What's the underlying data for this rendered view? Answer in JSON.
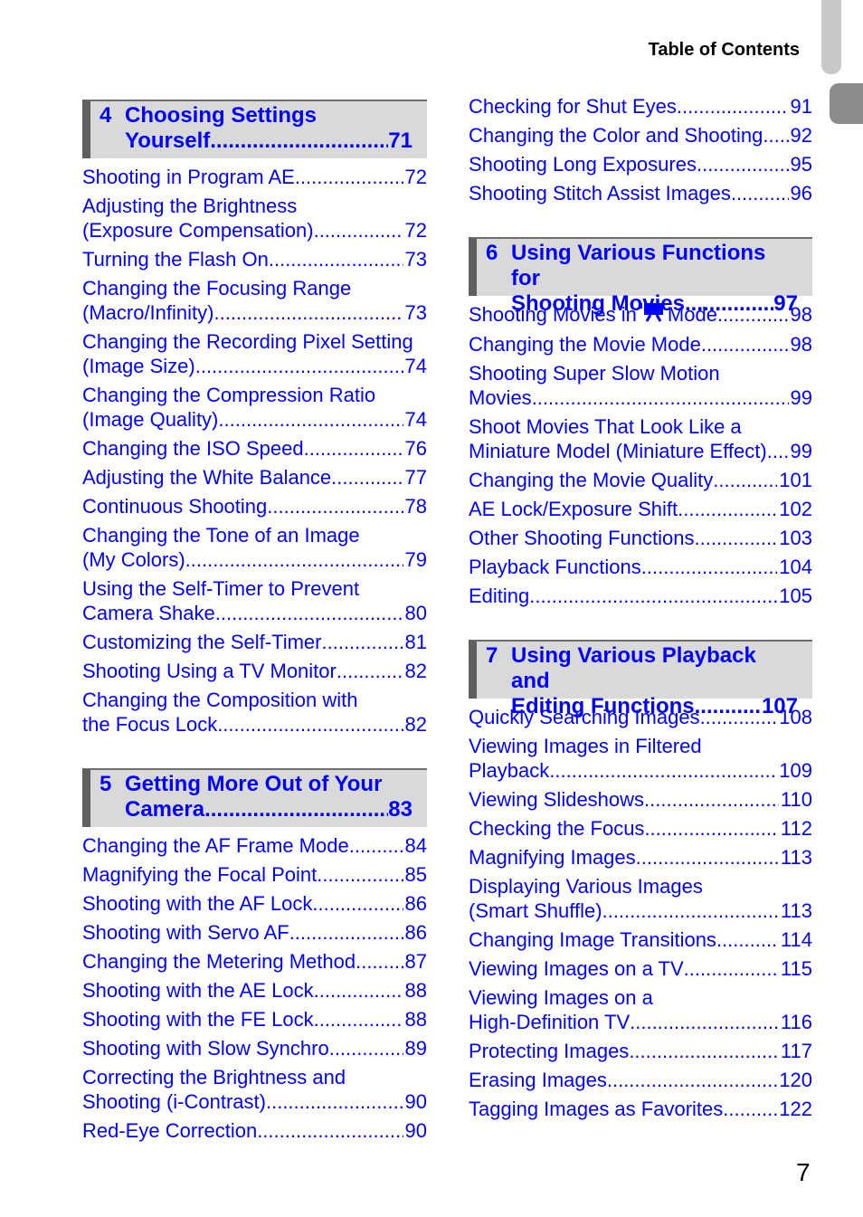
{
  "header": {
    "title": "Table of Contents"
  },
  "page_number": "7",
  "icons": {
    "movie_mode": "movie-camera-icon"
  },
  "left": [
    {
      "chapter": {
        "num": "4",
        "line1": "Choosing Settings",
        "line2": "Yourself",
        "page": "71"
      },
      "entries": [
        {
          "text": "Shooting in Program AE",
          "page": "72"
        },
        {
          "line1": "Adjusting the Brightness",
          "text": "(Exposure Compensation)",
          "page": "72"
        },
        {
          "text": "Turning the Flash On",
          "page": "73"
        },
        {
          "line1": "Changing the Focusing Range",
          "text": "(Macro/Infinity)",
          "page": "73"
        },
        {
          "line1": "Changing the Recording Pixel Setting",
          "text": "(Image Size)",
          "page": "74"
        },
        {
          "line1": "Changing the Compression Ratio",
          "text": "(Image Quality)",
          "page": "74"
        },
        {
          "text": "Changing the ISO Speed",
          "page": "76"
        },
        {
          "text": "Adjusting the White Balance",
          "page": "77"
        },
        {
          "text": "Continuous Shooting",
          "page": "78"
        },
        {
          "line1": "Changing the Tone of an Image",
          "text": "(My Colors)",
          "page": "79"
        },
        {
          "line1": "Using the Self-Timer to Prevent",
          "text": "Camera Shake",
          "page": "80"
        },
        {
          "text": "Customizing the Self-Timer",
          "page": "81"
        },
        {
          "text": "Shooting Using a TV Monitor",
          "page": "82"
        },
        {
          "line1": "Changing the Composition with",
          "text": "the Focus Lock",
          "page": "82"
        }
      ]
    },
    {
      "chapter": {
        "num": "5",
        "line1": "Getting More Out of Your",
        "line2": "Camera",
        "page": "83"
      },
      "entries": [
        {
          "text": "Changing the AF Frame Mode",
          "page": "84"
        },
        {
          "text": "Magnifying the Focal Point",
          "page": "85"
        },
        {
          "text": "Shooting with the AF Lock",
          "page": "86"
        },
        {
          "text": "Shooting with Servo AF",
          "page": "86"
        },
        {
          "text": "Changing the Metering Method",
          "page": "87"
        },
        {
          "text": "Shooting with the AE Lock",
          "page": "88"
        },
        {
          "text": "Shooting with the FE Lock",
          "page": "88"
        },
        {
          "text": "Shooting with Slow Synchro",
          "page": "89"
        },
        {
          "line1": "Correcting the Brightness and",
          "text": "Shooting (i-Contrast)",
          "page": "90"
        },
        {
          "text": "Red-Eye Correction",
          "page": "90"
        }
      ]
    }
  ],
  "right_top": [
    {
      "text": "Checking for Shut Eyes",
      "page": "91"
    },
    {
      "text": "Changing the Color and Shooting",
      "page": "92"
    },
    {
      "text": "Shooting Long Exposures",
      "page": "95"
    },
    {
      "text": "Shooting Stitch Assist Images",
      "page": "96"
    }
  ],
  "right": [
    {
      "chapter": {
        "num": "6",
        "line1": "Using Various Functions for",
        "line2": "Shooting Movies",
        "page": "97"
      },
      "movie_entry": {
        "before": "Shooting Movies in",
        "after": "Mode",
        "page": "98"
      },
      "entries": [
        {
          "text": "Changing the Movie Mode",
          "page": "98"
        },
        {
          "line1": "Shooting Super Slow Motion",
          "text": "Movies",
          "page": "99"
        },
        {
          "line1": "Shoot Movies That Look Like a",
          "text": "Miniature Model (Miniature Effect)",
          "page": "99"
        },
        {
          "text": "Changing the Movie Quality",
          "page": "101"
        },
        {
          "text": "AE Lock/Exposure Shift",
          "page": "102"
        },
        {
          "text": "Other Shooting Functions",
          "page": "103"
        },
        {
          "text": "Playback Functions",
          "page": "104"
        },
        {
          "text": "Editing",
          "page": "105"
        }
      ]
    },
    {
      "chapter": {
        "num": "7",
        "line1": "Using Various Playback and",
        "line2": "Editing Functions",
        "page": "107"
      },
      "entries": [
        {
          "text": "Quickly Searching Images",
          "page": "108"
        },
        {
          "line1": "Viewing Images in Filtered",
          "text": "Playback",
          "page": "109"
        },
        {
          "text": "Viewing Slideshows",
          "page": "110"
        },
        {
          "text": "Checking the Focus",
          "page": "112"
        },
        {
          "text": "Magnifying Images",
          "page": "113"
        },
        {
          "line1": "Displaying Various Images",
          "text": "(Smart Shuffle)",
          "page": "113"
        },
        {
          "text": "Changing Image Transitions",
          "page": "114"
        },
        {
          "text": "Viewing Images on a TV",
          "page": "115"
        },
        {
          "line1": "Viewing Images on a",
          "text": "High-Definition TV",
          "page": "116"
        },
        {
          "text": "Protecting Images",
          "page": "117"
        },
        {
          "text": "Erasing Images",
          "page": "120"
        },
        {
          "text": "Tagging Images as Favorites",
          "page": "122"
        }
      ]
    }
  ]
}
